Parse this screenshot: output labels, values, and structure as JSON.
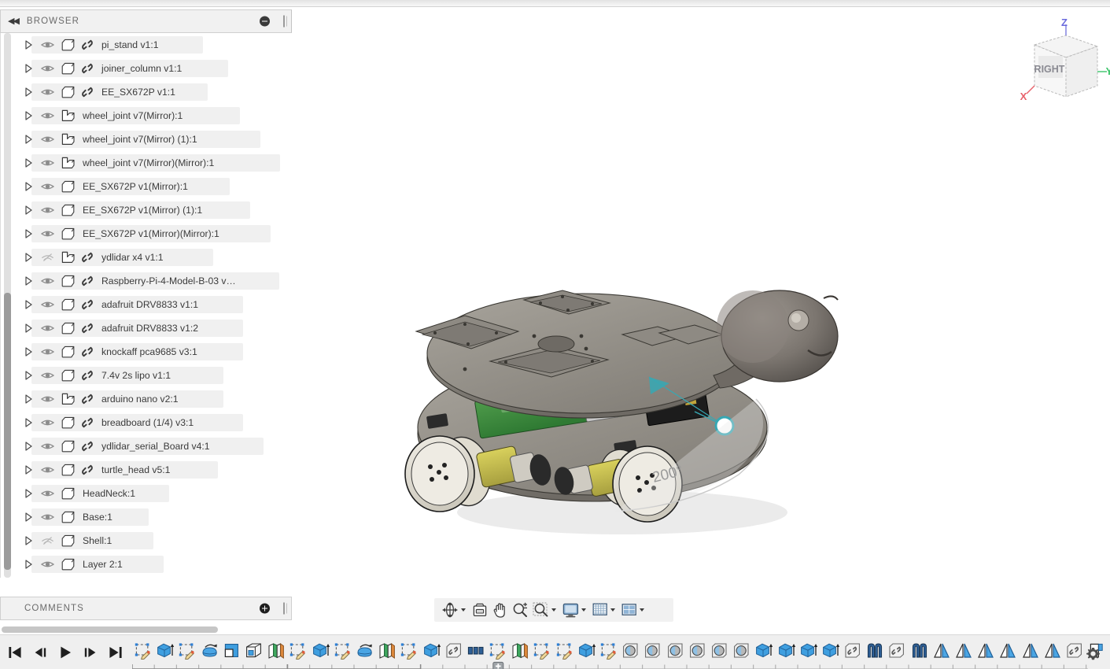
{
  "app": {
    "browser_panel": {
      "title": "BROWSER",
      "collapse_icon": "double-left-arrows-icon",
      "minus_icon": "minus-circle-icon"
    },
    "comments_panel": {
      "title": "COMMENTS",
      "add_icon": "plus-circle-icon"
    }
  },
  "browser": {
    "nodes": [
      {
        "label": "pi_stand v1:1",
        "visible": true,
        "type": "component",
        "linked": true
      },
      {
        "label": "joiner_column v1:1",
        "visible": true,
        "type": "component",
        "linked": true
      },
      {
        "label": "EE_SX672P v1:1",
        "visible": true,
        "type": "component",
        "linked": true
      },
      {
        "label": "wheel_joint v7(Mirror):1",
        "visible": true,
        "type": "body",
        "linked": false
      },
      {
        "label": "wheel_joint v7(Mirror) (1):1",
        "visible": true,
        "type": "body",
        "linked": false
      },
      {
        "label": "wheel_joint v7(Mirror)(Mirror):1",
        "visible": true,
        "type": "body",
        "linked": false
      },
      {
        "label": "EE_SX672P v1(Mirror):1",
        "visible": true,
        "type": "component",
        "linked": false
      },
      {
        "label": "EE_SX672P v1(Mirror) (1):1",
        "visible": true,
        "type": "component",
        "linked": false
      },
      {
        "label": "EE_SX672P v1(Mirror)(Mirror):1",
        "visible": true,
        "type": "component",
        "linked": false
      },
      {
        "label": "ydlidar x4 v1:1",
        "visible": false,
        "type": "body",
        "linked": true
      },
      {
        "label": "Raspberry-Pi-4-Model-B-03 v…",
        "visible": true,
        "type": "component",
        "linked": true
      },
      {
        "label": "adafruit DRV8833 v1:1",
        "visible": true,
        "type": "component",
        "linked": true
      },
      {
        "label": "adafruit DRV8833 v1:2",
        "visible": true,
        "type": "component",
        "linked": true
      },
      {
        "label": "knockaff pca9685 v3:1",
        "visible": true,
        "type": "component",
        "linked": true
      },
      {
        "label": "7.4v 2s lipo v1:1",
        "visible": true,
        "type": "component",
        "linked": true
      },
      {
        "label": "arduino nano v2:1",
        "visible": true,
        "type": "body",
        "linked": true
      },
      {
        "label": "breadboard (1/4) v3:1",
        "visible": true,
        "type": "component",
        "linked": true
      },
      {
        "label": "ydlidar_serial_Board v4:1",
        "visible": true,
        "type": "component",
        "linked": true
      },
      {
        "label": "turtle_head v5:1",
        "visible": true,
        "type": "component",
        "linked": true
      },
      {
        "label": "HeadNeck:1",
        "visible": true,
        "type": "component",
        "linked": false
      },
      {
        "label": "Base:1",
        "visible": true,
        "type": "component",
        "linked": false
      },
      {
        "label": "Shell:1",
        "visible": false,
        "type": "component",
        "linked": false
      },
      {
        "label": "Layer 2:1",
        "visible": true,
        "type": "component",
        "linked": false
      }
    ]
  },
  "canvas": {
    "viewcube": {
      "face_label": "RIGHT",
      "axes": [
        {
          "name": "Z",
          "color": "#6b6bdd"
        },
        {
          "name": "Y",
          "color": "#3cc46a"
        },
        {
          "name": "X",
          "color": "#e8616b"
        }
      ]
    },
    "annotations": [
      {
        "name": "joint-angle",
        "value": "200°",
        "color": "#9a9a9a"
      }
    ],
    "joint_handle_color": "#36a8b4"
  },
  "view_toolbar": {
    "items": [
      {
        "name": "orbit-icon",
        "caret": true
      },
      {
        "name": "look-at-icon",
        "caret": false
      },
      {
        "name": "pan-hand-icon",
        "caret": false
      },
      {
        "name": "zoom-icon",
        "caret": false
      },
      {
        "name": "zoom-window-icon",
        "caret": true
      },
      {
        "name": "display-settings-icon",
        "caret": true
      },
      {
        "name": "grid-snap-icon",
        "caret": true
      },
      {
        "name": "viewports-icon",
        "caret": true
      }
    ]
  },
  "timeline": {
    "playback": [
      {
        "name": "go-to-beginning-button"
      },
      {
        "name": "step-back-button"
      },
      {
        "name": "play-button"
      },
      {
        "name": "step-forward-button"
      },
      {
        "name": "go-to-end-button"
      }
    ],
    "settings_icon": "gear-icon",
    "marker_icon": "plus-marker",
    "features": [
      "sketch",
      "extrude",
      "sketch",
      "revolve",
      "fillet",
      "shell",
      "mirror-plane",
      "sketch",
      "extrude",
      "sketch",
      "revolve",
      "mirror-plane",
      "sketch",
      "extrude",
      "component",
      "pattern",
      "sketch",
      "mirror-plane",
      "sketch",
      "sketch",
      "extrude",
      "sketch",
      "joint",
      "joint",
      "joint",
      "joint",
      "joint",
      "joint",
      "extrude",
      "extrude",
      "extrude",
      "extrude",
      "component",
      "as-built-joint",
      "component",
      "as-built-joint",
      "mirror",
      "mirror",
      "mirror",
      "mirror",
      "mirror",
      "mirror",
      "component",
      "move"
    ],
    "group_brackets": [
      {
        "start": 0,
        "end": 6
      },
      {
        "start": 7,
        "end": 12
      }
    ]
  }
}
